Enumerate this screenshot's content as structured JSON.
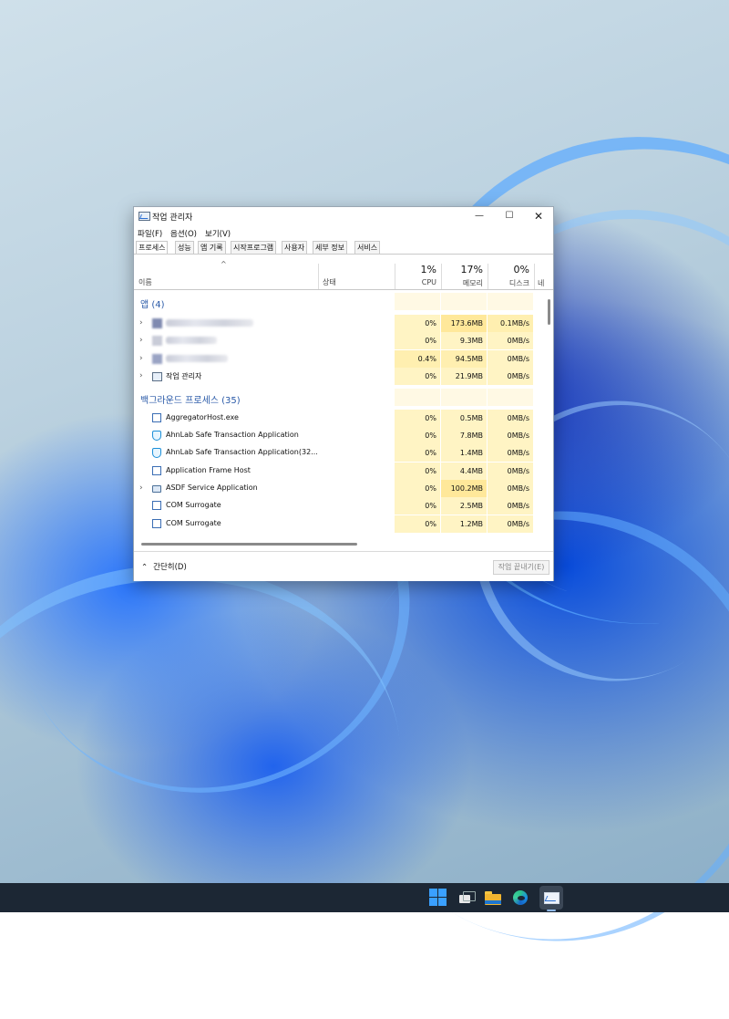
{
  "window": {
    "title": "작업 관리자",
    "controls": {
      "minimize": "—",
      "maximize": "☐",
      "close": "✕"
    }
  },
  "menu": [
    "파일(F)",
    "옵션(O)",
    "보기(V)"
  ],
  "tabs": [
    "프로세스",
    "성능",
    "앱 기록",
    "시작프로그램",
    "사용자",
    "세부 정보",
    "서비스"
  ],
  "active_tab": "프로세스",
  "header": {
    "sort_indicator": "^",
    "name": "이름",
    "status": "상태",
    "cpu_pct": "1%",
    "cpu": "CPU",
    "mem_pct": "17%",
    "mem": "메모리",
    "disk_pct": "0%",
    "disk": "디스크",
    "net": "네"
  },
  "groups": {
    "apps": "앱 (4)",
    "background": "백그라운드 프로세스 (35)"
  },
  "apps": [
    {
      "name": "",
      "obscured": true,
      "cpu": "0%",
      "mem": "173.6MB",
      "disk": "0.1MB/s"
    },
    {
      "name": "",
      "obscured": true,
      "cpu": "0%",
      "mem": "9.3MB",
      "disk": "0MB/s"
    },
    {
      "name": "",
      "obscured": true,
      "cpu": "0.4%",
      "mem": "94.5MB",
      "disk": "0MB/s"
    },
    {
      "name": "작업 관리자",
      "obscured": false,
      "cpu": "0%",
      "mem": "21.9MB",
      "disk": "0MB/s"
    }
  ],
  "background": [
    {
      "name": "AggregatorHost.exe",
      "icon": "window-icon",
      "cpu": "0%",
      "mem": "0.5MB",
      "disk": "0MB/s"
    },
    {
      "name": "AhnLab Safe Transaction Application",
      "icon": "shield-icon",
      "cpu": "0%",
      "mem": "7.8MB",
      "disk": "0MB/s"
    },
    {
      "name": "AhnLab Safe Transaction Application(32...",
      "icon": "shield-icon",
      "cpu": "0%",
      "mem": "1.4MB",
      "disk": "0MB/s"
    },
    {
      "name": "Application Frame Host",
      "icon": "window-icon",
      "cpu": "0%",
      "mem": "4.4MB",
      "disk": "0MB/s"
    },
    {
      "name": "ASDF Service Application",
      "icon": "printer-icon",
      "cpu": "0%",
      "mem": "100.2MB",
      "disk": "0MB/s"
    },
    {
      "name": "COM Surrogate",
      "icon": "window-icon",
      "cpu": "0%",
      "mem": "2.5MB",
      "disk": "0MB/s"
    },
    {
      "name": "COM Surrogate",
      "icon": "window-icon",
      "cpu": "0%",
      "mem": "1.2MB",
      "disk": "0MB/s"
    }
  ],
  "footer": {
    "fewer_details": "간단히(D)",
    "end_task": "작업 끝내기(E)"
  },
  "taskbar": [
    "start-icon",
    "task-view-icon",
    "file-explorer-icon",
    "edge-icon",
    "task-manager-icon"
  ]
}
